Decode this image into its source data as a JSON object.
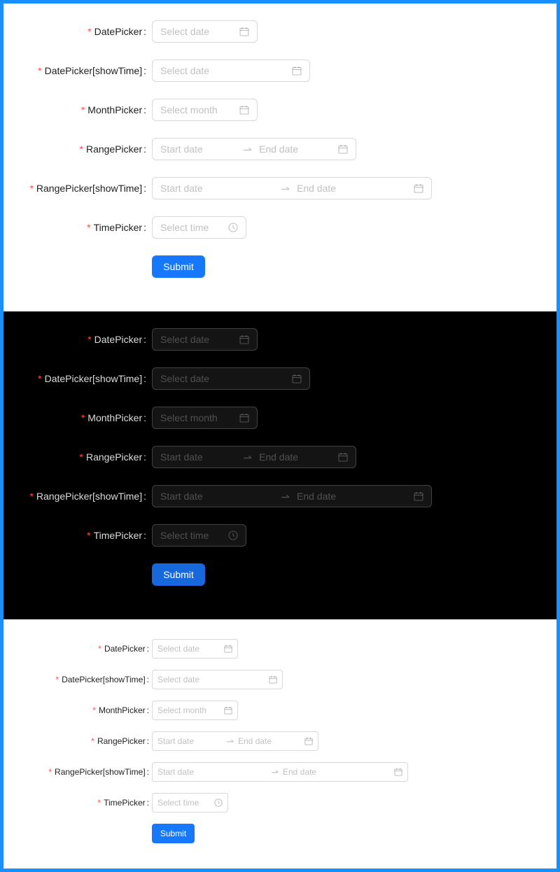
{
  "colors": {
    "primary": "#1677ff",
    "required_mark": "#ff4d4f",
    "outer_border": "#1890ff",
    "dark_bg": "#000000"
  },
  "labels": {
    "date_picker": "DatePicker",
    "date_picker_show_time": "DatePicker[showTime]",
    "month_picker": "MonthPicker",
    "range_picker": "RangePicker",
    "range_picker_show_time": "RangePicker[showTime]",
    "time_picker": "TimePicker",
    "required_mark": "*",
    "colon": ":"
  },
  "placeholders": {
    "select_date": "Select date",
    "select_month": "Select month",
    "start_date": "Start date",
    "end_date": "End date",
    "select_time": "Select time"
  },
  "submit_label": "Submit",
  "icons": {
    "calendar": "calendar-icon",
    "clock": "clock-icon",
    "arrow": "swap-right-icon"
  }
}
